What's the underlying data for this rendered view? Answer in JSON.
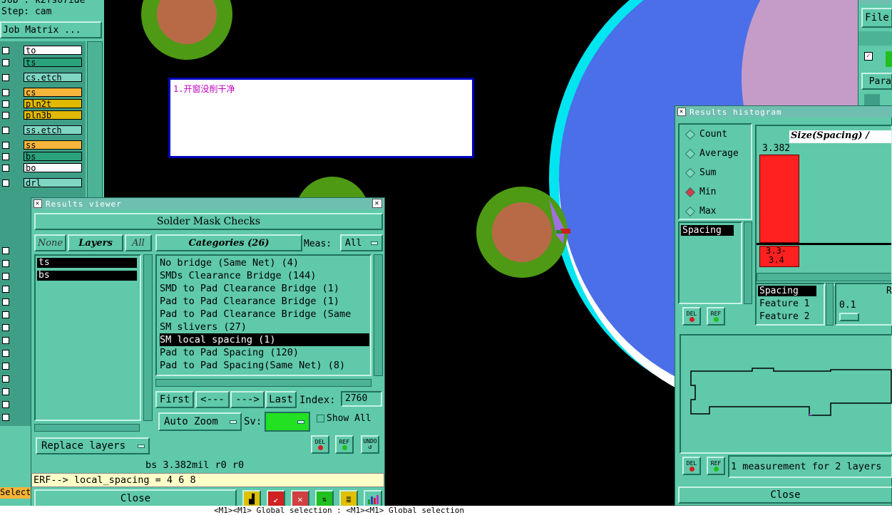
{
  "left_panel": {
    "job_line": "Job : k2fs07ide",
    "step_line": "Step: cam",
    "job_matrix_button": "Job Matrix ...",
    "layers": [
      {
        "name": "to",
        "color": "#ffffff"
      },
      {
        "name": "ts",
        "color": "#2aa37d"
      },
      {
        "name": "cs.etch",
        "color": "#7fd7c2"
      },
      {
        "name": "cs",
        "color": "#f5b43a"
      },
      {
        "name": "pln2t",
        "color": "#e0b800"
      },
      {
        "name": "pln3b",
        "color": "#e0b800"
      },
      {
        "name": "ss.etch",
        "color": "#7fd7c2"
      },
      {
        "name": "ss",
        "color": "#f5b43a"
      },
      {
        "name": "bs",
        "color": "#2aa37d"
      },
      {
        "name": "bo",
        "color": "#ffffff"
      },
      {
        "name": "drl",
        "color": "#7fd7c2"
      }
    ],
    "select_label": "Select"
  },
  "canvas": {
    "note_text": "1.开窗没削干净",
    "colors": {
      "pad_ring": "#4e9a14",
      "pad_core": "#b86a47",
      "blue": "#4b6fe8",
      "cyan": "#00e5f0",
      "lavender": "#c59cc8",
      "marker": "#a070e0"
    }
  },
  "results_viewer": {
    "title": "Results viewer",
    "header": "Solder Mask Checks",
    "none_btn": "None",
    "layers_btn": "Layers",
    "all_btn": "All",
    "layer_list": [
      "ts",
      "bs"
    ],
    "categories_btn": "Categories (26)",
    "meas_label": "Meas:",
    "meas_value": "All",
    "categories": [
      "No bridge (Same Net) (4)",
      "SMDs Clearance Bridge (144)",
      "SMD to Pad Clearance Bridge (1)",
      "Pad to Pad Clearance Bridge (1)",
      "Pad to Pad Clearance Bridge (Same",
      "SM slivers (27)",
      "SM local spacing (1)",
      "Pad to Pad Spacing (120)",
      "Pad to Pad Spacing(Same Net) (8)"
    ],
    "selected_category_index": 6,
    "first_btn": "First",
    "prev_btn": "<---",
    "next_btn": "--->",
    "last_btn": "Last",
    "index_label": "Index:",
    "index_value": "2760",
    "auto_zoom_btn": "Auto Zoom",
    "sv_label": "Sv:",
    "show_all_label": "Show All",
    "replace_layers_btn": "Replace layers",
    "del_label": "DEL",
    "ref_label": "REF",
    "undo_label": "UNDO",
    "status_line": "bs 3.382mil  r0  r0",
    "erf_line": "ERF--> local_spacing = 4 6 8",
    "close_btn": "Close"
  },
  "histogram": {
    "title": "Results histogram",
    "radios": [
      {
        "label": "Count",
        "selected": false
      },
      {
        "label": "Average",
        "selected": false
      },
      {
        "label": "Sum",
        "selected": false
      },
      {
        "label": "Min",
        "selected": true
      },
      {
        "label": "Max",
        "selected": false
      }
    ],
    "measure_list": [
      "Spacing"
    ],
    "chart_title": "Size(Spacing) /",
    "bar_value_label": "3.382",
    "bar_range_label_1": "3.3-",
    "bar_range_label_2": "3.4",
    "field_list": [
      "Spacing",
      "Feature 1",
      "Feature 2"
    ],
    "range_header": "R",
    "range_value": "0.1",
    "del_label": "DEL",
    "ref_label": "REF",
    "status_text": "1 measurement for 2 layers",
    "close_btn": "Close"
  },
  "right_top": {
    "file_menu": "File",
    "para_label": "Para"
  },
  "bottom_status": "<M1><M1> Global selection : <M1><M1> Global selection"
}
